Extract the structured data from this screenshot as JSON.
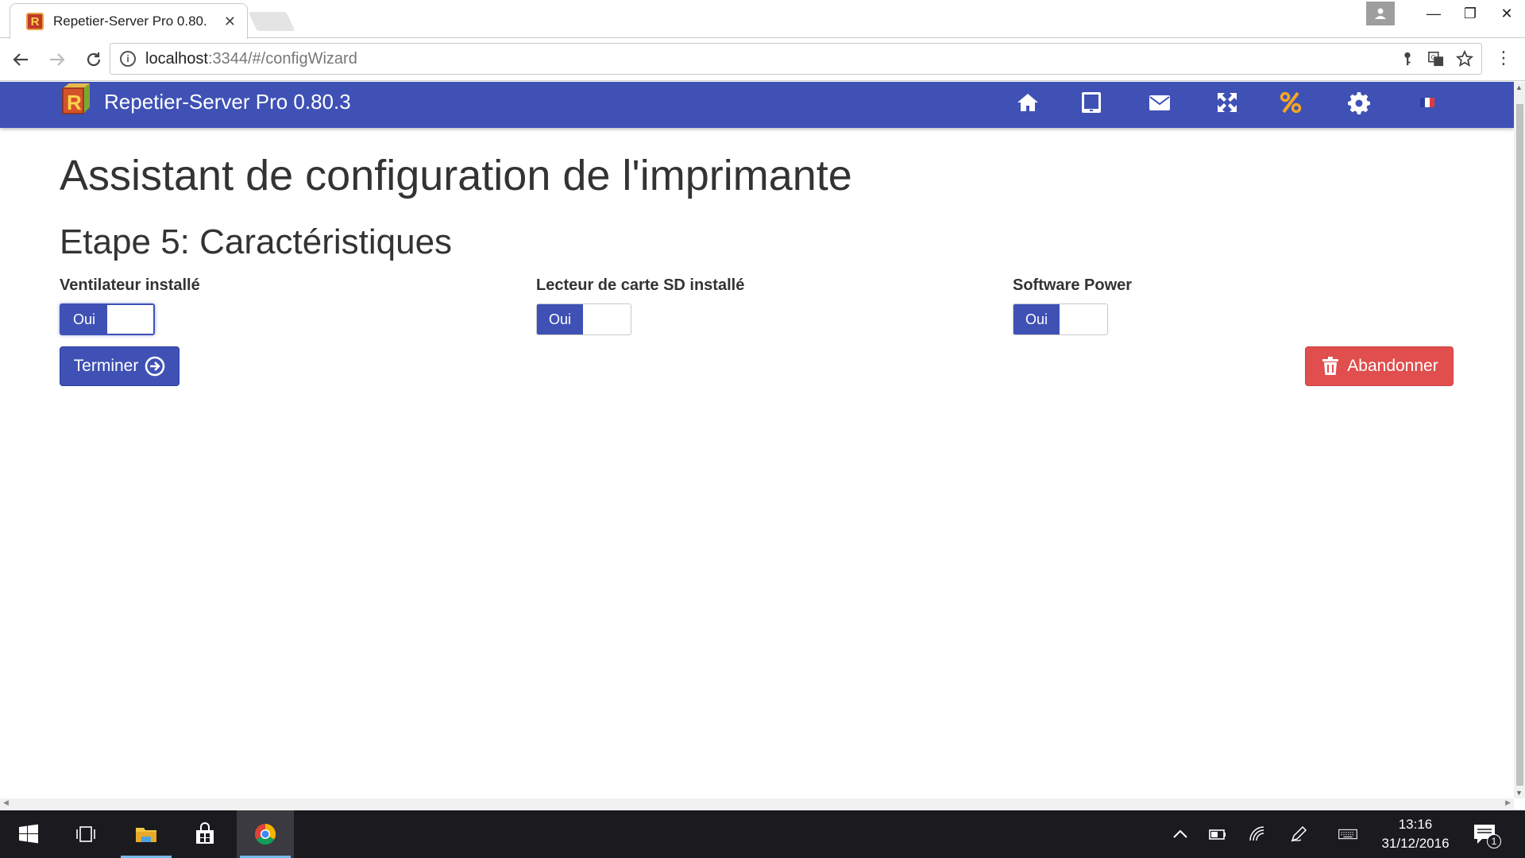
{
  "browser": {
    "tab_title": "Repetier-Server Pro 0.80.",
    "tab_favicon": "R",
    "close_glyph": "✕",
    "url_host": "localhost",
    "url_path": ":3344/#/configWizard",
    "window_minimize": "—",
    "window_restore": "❐",
    "window_close": "✕",
    "menu_glyph": "⋮"
  },
  "app": {
    "title": "Repetier-Server Pro 0.80.3",
    "accent_color": "#3f51b5",
    "nav_icons": [
      "home-icon",
      "tablet-icon",
      "envelope-icon",
      "expand-icon",
      "percent-icon",
      "gear-icon",
      "french-flag-icon"
    ]
  },
  "wizard": {
    "page_title": "Assistant de configuration de l'imprimante",
    "step_title": "Etape 5: Caractéristiques",
    "features": [
      {
        "label": "Ventilateur installé",
        "toggle_label": "Oui",
        "value": "on"
      },
      {
        "label": "Lecteur de carte SD installé",
        "toggle_label": "Oui",
        "value": "on"
      },
      {
        "label": "Software Power",
        "toggle_label": "Oui",
        "value": "on"
      }
    ],
    "finish_label": "Terminer",
    "abort_label": "Abandonner",
    "danger_color": "#e04e4e"
  },
  "taskbar": {
    "time": "13:16",
    "date": "31/12/2016",
    "notification_count": "1"
  }
}
